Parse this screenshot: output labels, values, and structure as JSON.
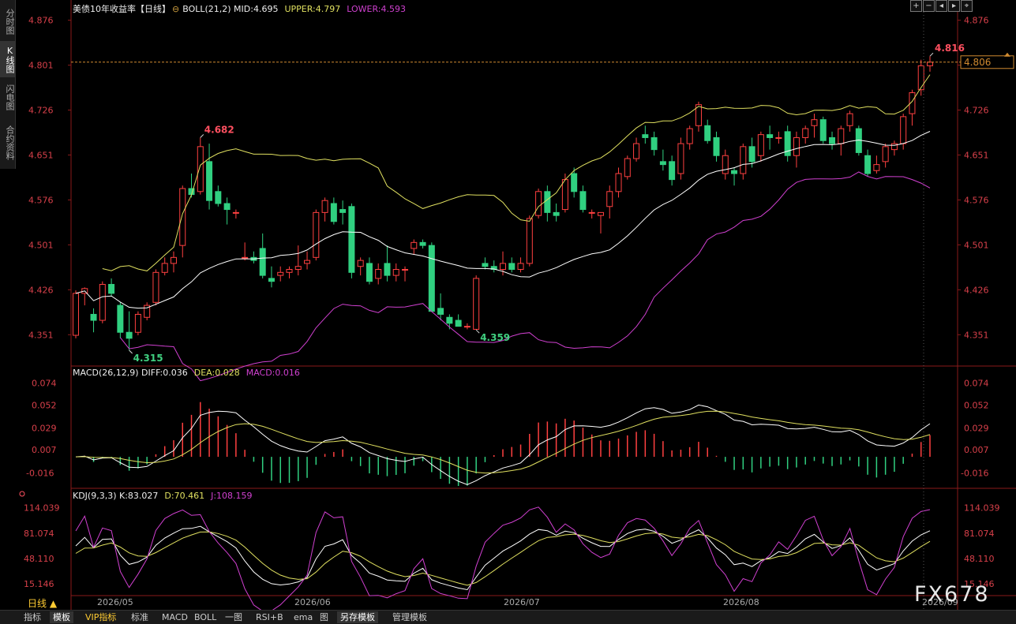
{
  "left_tabs": [
    "分时图",
    "K线图",
    "闪电图",
    "合约资料"
  ],
  "main_legend": {
    "title": "美债10年收益率【日线】",
    "boll": "BOLL(21,2) MID:4.695",
    "upper": "UPPER:4.797",
    "lower": "LOWER:4.593"
  },
  "macd_legend": {
    "name": "MACD(26,12,9) DIFF:0.036",
    "dea": "DEA:0.028",
    "macd": "MACD:0.016"
  },
  "kdj_legend": {
    "name": "KDJ(9,3,3) K:83.027",
    "d": "D:70.461",
    "j": "J:108.159"
  },
  "price_ticks": [
    "4.876",
    "4.801",
    "4.726",
    "4.651",
    "4.576",
    "4.501",
    "4.426",
    "4.351"
  ],
  "macd_ticks": [
    "0.074",
    "0.052",
    "0.029",
    "0.007",
    "-0.016"
  ],
  "kdj_ticks": [
    "114.039",
    "81.074",
    "48.110",
    "15.146"
  ],
  "annotations": {
    "high1": "4.682",
    "low1": "4.315",
    "low2": "4.359",
    "last_high": "4.816",
    "last_price": "4.806"
  },
  "dates": [
    "2026/05",
    "2026/06",
    "2026/07",
    "2026/08",
    "2026/09"
  ],
  "period": "日线 ▲",
  "bottom_tabs": [
    "指标",
    "模板",
    "VIP指标",
    "标准",
    "MACD",
    "BOLL",
    "一图",
    "RSI+B",
    "ema",
    "图",
    "另存模板",
    "管理模板"
  ],
  "watermark": "FX678",
  "colors": {
    "up": "#ff4040",
    "down": "#30d080",
    "mid": "#ffffff",
    "upper": "#e0e060",
    "lower": "#d040d0"
  },
  "chart_data": {
    "type": "candlestick",
    "series_ohlc": [
      [
        4.35,
        4.425,
        4.345,
        4.42
      ],
      [
        4.42,
        4.43,
        4.4,
        4.428
      ],
      [
        4.385,
        4.395,
        4.355,
        4.375
      ],
      [
        4.375,
        4.44,
        4.37,
        4.435
      ],
      [
        4.435,
        4.445,
        4.415,
        4.42
      ],
      [
        4.4,
        4.405,
        4.345,
        4.355
      ],
      [
        4.355,
        4.39,
        4.325,
        4.345
      ],
      [
        4.355,
        4.39,
        4.35,
        4.385
      ],
      [
        4.38,
        4.405,
        4.375,
        4.4
      ],
      [
        4.405,
        4.46,
        4.4,
        4.455
      ],
      [
        4.455,
        4.48,
        4.45,
        4.47
      ],
      [
        4.47,
        4.49,
        4.455,
        4.48
      ],
      [
        4.5,
        4.6,
        4.48,
        4.595
      ],
      [
        4.595,
        4.62,
        4.58,
        4.585
      ],
      [
        4.59,
        4.68,
        4.585,
        4.665
      ],
      [
        4.64,
        4.67,
        4.56,
        4.575
      ],
      [
        4.59,
        4.6,
        4.565,
        4.57
      ],
      [
        4.57,
        4.58,
        4.535,
        4.56
      ],
      [
        4.555,
        4.56,
        4.545,
        4.555
      ],
      [
        4.48,
        4.505,
        4.475,
        4.48
      ],
      [
        4.48,
        4.49,
        4.47,
        4.475
      ],
      [
        4.495,
        4.52,
        4.445,
        4.45
      ],
      [
        4.445,
        4.465,
        4.43,
        4.44
      ],
      [
        4.45,
        4.465,
        4.44,
        4.455
      ],
      [
        4.455,
        4.465,
        4.445,
        4.46
      ],
      [
        4.46,
        4.5,
        4.45,
        4.465
      ],
      [
        4.47,
        4.49,
        4.46,
        4.475
      ],
      [
        4.48,
        4.56,
        4.475,
        4.555
      ],
      [
        4.555,
        4.58,
        4.54,
        4.575
      ],
      [
        4.57,
        4.58,
        4.535,
        4.54
      ],
      [
        4.56,
        4.575,
        4.535,
        4.555
      ],
      [
        4.565,
        4.57,
        4.445,
        4.455
      ],
      [
        4.465,
        4.48,
        4.45,
        4.475
      ],
      [
        4.47,
        4.48,
        4.435,
        4.44
      ],
      [
        4.445,
        4.47,
        4.435,
        4.46
      ],
      [
        4.47,
        4.5,
        4.44,
        4.45
      ],
      [
        4.45,
        4.47,
        4.44,
        4.46
      ],
      [
        4.46,
        4.465,
        4.44,
        4.46
      ],
      [
        4.495,
        4.51,
        4.485,
        4.505
      ],
      [
        4.505,
        4.51,
        4.495,
        4.5
      ],
      [
        4.5,
        4.505,
        4.4,
        4.39
      ],
      [
        4.395,
        4.42,
        4.375,
        4.385
      ],
      [
        4.38,
        4.385,
        4.36,
        4.37
      ],
      [
        4.375,
        4.385,
        4.365,
        4.365
      ],
      [
        4.365,
        4.37,
        4.36,
        4.365
      ],
      [
        4.36,
        4.45,
        4.359,
        4.445
      ],
      [
        4.47,
        4.48,
        4.46,
        4.465
      ],
      [
        4.465,
        4.475,
        4.455,
        4.46
      ],
      [
        4.46,
        4.49,
        4.45,
        4.47
      ],
      [
        4.47,
        4.48,
        4.455,
        4.46
      ],
      [
        4.46,
        4.48,
        4.455,
        4.47
      ],
      [
        4.47,
        4.55,
        4.465,
        4.545
      ],
      [
        4.55,
        4.595,
        4.545,
        4.59
      ],
      [
        4.59,
        4.6,
        4.54,
        4.555
      ],
      [
        4.555,
        4.57,
        4.54,
        4.55
      ],
      [
        4.56,
        4.62,
        4.555,
        4.61
      ],
      [
        4.62,
        4.63,
        4.58,
        4.59
      ],
      [
        4.59,
        4.6,
        4.555,
        4.56
      ],
      [
        4.555,
        4.56,
        4.545,
        4.555
      ],
      [
        4.55,
        4.555,
        4.52,
        4.555
      ],
      [
        4.565,
        4.6,
        4.545,
        4.59
      ],
      [
        4.59,
        4.63,
        4.58,
        4.62
      ],
      [
        4.615,
        4.65,
        4.61,
        4.645
      ],
      [
        4.645,
        4.68,
        4.64,
        4.67
      ],
      [
        4.685,
        4.7,
        4.67,
        4.68
      ],
      [
        4.68,
        4.69,
        4.65,
        4.66
      ],
      [
        4.64,
        4.66,
        4.625,
        4.635
      ],
      [
        4.64,
        4.65,
        4.6,
        4.61
      ],
      [
        4.62,
        4.68,
        4.61,
        4.67
      ],
      [
        4.67,
        4.7,
        4.66,
        4.695
      ],
      [
        4.7,
        4.74,
        4.69,
        4.735
      ],
      [
        4.7,
        4.71,
        4.67,
        4.675
      ],
      [
        4.68,
        4.69,
        4.64,
        4.65
      ],
      [
        4.62,
        4.66,
        4.61,
        4.65
      ],
      [
        4.625,
        4.63,
        4.6,
        4.62
      ],
      [
        4.62,
        4.67,
        4.61,
        4.665
      ],
      [
        4.665,
        4.68,
        4.63,
        4.64
      ],
      [
        4.65,
        4.69,
        4.64,
        4.685
      ],
      [
        4.685,
        4.7,
        4.66,
        4.68
      ],
      [
        4.68,
        4.69,
        4.67,
        4.68
      ],
      [
        4.69,
        4.7,
        4.64,
        4.65
      ],
      [
        4.65,
        4.69,
        4.63,
        4.68
      ],
      [
        4.68,
        4.7,
        4.67,
        4.695
      ],
      [
        4.7,
        4.72,
        4.68,
        4.71
      ],
      [
        4.71,
        4.715,
        4.67,
        4.675
      ],
      [
        4.68,
        4.69,
        4.66,
        4.67
      ],
      [
        4.67,
        4.7,
        4.65,
        4.695
      ],
      [
        4.7,
        4.725,
        4.69,
        4.72
      ],
      [
        4.695,
        4.7,
        4.65,
        4.655
      ],
      [
        4.65,
        4.66,
        4.615,
        4.62
      ],
      [
        4.625,
        4.65,
        4.62,
        4.635
      ],
      [
        4.64,
        4.67,
        4.63,
        4.665
      ],
      [
        4.66,
        4.675,
        4.65,
        4.67
      ],
      [
        4.67,
        4.72,
        4.66,
        4.715
      ],
      [
        4.72,
        4.76,
        4.7,
        4.755
      ],
      [
        4.76,
        4.81,
        4.75,
        4.8
      ],
      [
        4.8,
        4.816,
        4.79,
        4.806
      ]
    ],
    "ylim": [
      4.3,
      4.89
    ],
    "macd_ylim": [
      -0.03,
      0.08
    ],
    "kdj_ylim": [
      0,
      125
    ]
  }
}
